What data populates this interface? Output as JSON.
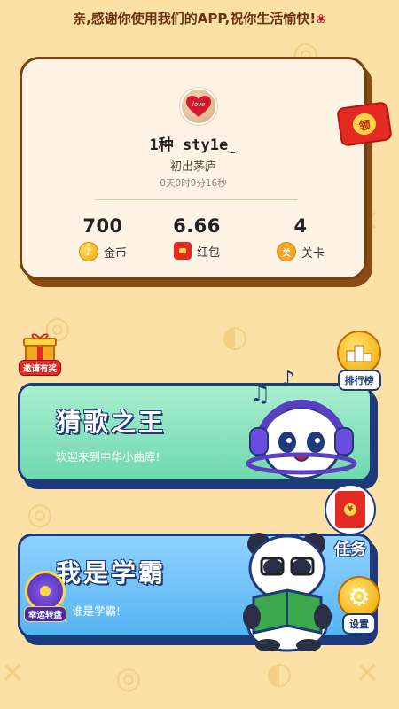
{
  "banner": {
    "text": "亲,感谢你使用我们的APP,祝你生活愉快!",
    "rose_icon": "rose-icon"
  },
  "profile": {
    "username": "1种 sty1e‿",
    "rank_title": "初出茅庐",
    "play_time": "0天0时9分16秒",
    "avatar_text": "love",
    "stats": [
      {
        "value": "700",
        "label": "金币",
        "icon": "coin-icon"
      },
      {
        "value": "6.66",
        "label": "红包",
        "icon": "red-envelope-icon"
      },
      {
        "value": "4",
        "label": "关卡",
        "icon": "level-icon"
      }
    ],
    "red_packet_label": "领"
  },
  "cards": {
    "guess_song": {
      "title": "猜歌之王",
      "subtitle": "欢迎来到中华小曲库!"
    },
    "scholar": {
      "title": "我是学霸",
      "subtitle": "谁是学霸!"
    }
  },
  "badges": {
    "invite": "邀请有奖",
    "ranking": "排行榜",
    "task": "任务",
    "lucky_wheel": "幸运转盘",
    "settings": "设置"
  },
  "colors": {
    "background": "#fbe1a6",
    "card_border": "#1e3a7a",
    "green_card": "#6fd9ae",
    "blue_card": "#56b4f2",
    "accent_red": "#e32b24"
  }
}
